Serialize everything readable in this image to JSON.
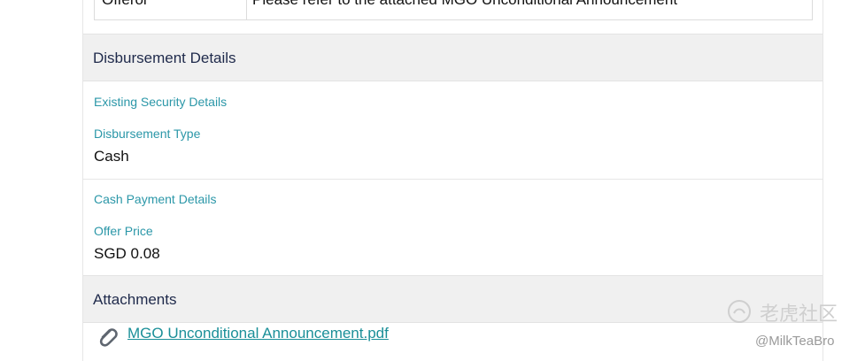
{
  "offeror": {
    "label": "Offeror",
    "value": "Please refer to the attached MGO Unconditional Announcement"
  },
  "disbursement": {
    "header": "Disbursement Details",
    "existing_security_label": "Existing Security Details",
    "type_label": "Disbursement Type",
    "type_value": "Cash",
    "cash_payment_label": "Cash Payment Details",
    "offer_price_label": "Offer Price",
    "offer_price_value": "SGD 0.08"
  },
  "attachments": {
    "header": "Attachments",
    "files": [
      {
        "name": "MGO Unconditional Announcement.pdf",
        "icon": "paperclip-icon"
      }
    ]
  },
  "watermark": {
    "brand": "老虎社区",
    "handle": "@MilkTeaBro"
  },
  "colors": {
    "accent_teal": "#2b97a8",
    "link": "#1a8f98",
    "header_bg": "#f0f0f0",
    "header_text": "#1f2a4b"
  }
}
